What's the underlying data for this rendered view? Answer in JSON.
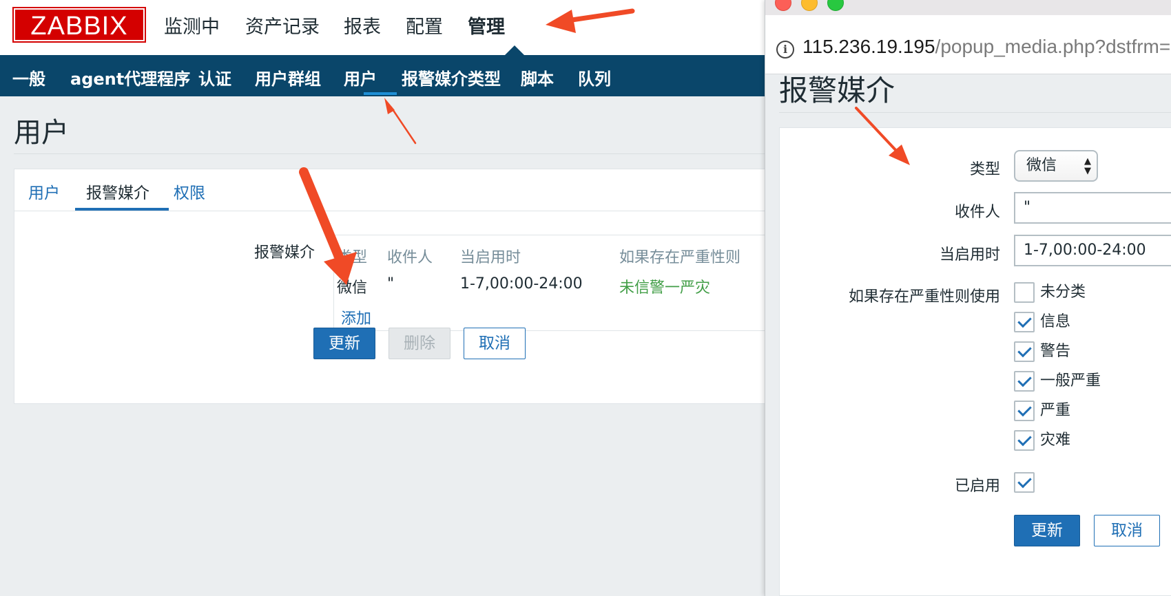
{
  "header": {
    "logo": "ZABBIX",
    "nav": [
      "监测中",
      "资产记录",
      "报表",
      "配置",
      "管理"
    ]
  },
  "subnav": [
    "一般",
    "agent代理程序",
    "认证",
    "用户群组",
    "用户",
    "报警媒介类型",
    "脚本",
    "队列"
  ],
  "page": {
    "title": "用户",
    "tabs": [
      "用户",
      "报警媒介",
      "权限"
    ],
    "media_label": "报警媒介",
    "table": {
      "headers": [
        "类型",
        "收件人",
        "当启用时",
        "如果存在严重性则"
      ],
      "row": {
        "type": "微信",
        "recipient": "\"",
        "when_active": "1-7,00:00-24:00",
        "severity": "未信警一严灾"
      }
    },
    "add_link": "添加",
    "buttons": {
      "update": "更新",
      "delete": "删除",
      "cancel": "取消"
    }
  },
  "popup": {
    "url_host": "115.236.19.195",
    "url_path": "/popup_media.php?dstfrm=",
    "title": "报警媒介",
    "form": {
      "type_label": "类型",
      "type_value": "微信",
      "sendto_label": "收件人",
      "sendto_value": "\"",
      "period_label": "当启用时",
      "period_value": "1-7,00:00-24:00",
      "severity_label": "如果存在严重性则使用",
      "severities": [
        {
          "label": "未分类",
          "checked": false
        },
        {
          "label": "信息",
          "checked": true
        },
        {
          "label": "警告",
          "checked": true
        },
        {
          "label": "一般严重",
          "checked": true
        },
        {
          "label": "严重",
          "checked": true
        },
        {
          "label": "灾难",
          "checked": true
        }
      ],
      "enabled_label": "已启用",
      "enabled": true
    },
    "buttons": {
      "update": "更新",
      "cancel": "取消"
    }
  },
  "colors": {
    "brand_red": "#d40000",
    "nav_blue": "#0a466a",
    "link_blue": "#1f6fb5",
    "severity_green": "#429e47",
    "annotation_arrow": "#f04a26"
  }
}
